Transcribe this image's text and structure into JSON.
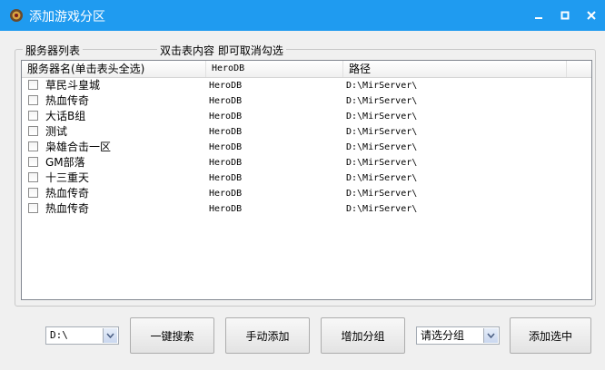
{
  "window": {
    "title": "添加游戏分区"
  },
  "group": {
    "label_left": "服务器列表",
    "label_right": "双击表内容 即可取消勾选"
  },
  "table": {
    "columns": [
      "服务器名(单击表头全选)",
      "HeroDB",
      "路径"
    ],
    "rows": [
      {
        "name": "草民斗皇城",
        "db": "HeroDB",
        "path": "D:\\MirServer\\"
      },
      {
        "name": "热血传奇",
        "db": "HeroDB",
        "path": "D:\\MirServer\\"
      },
      {
        "name": "大话B组",
        "db": "HeroDB",
        "path": "D:\\MirServer\\"
      },
      {
        "name": "测试",
        "db": "HeroDB",
        "path": "D:\\MirServer\\"
      },
      {
        "name": "枭雄合击一区",
        "db": "HeroDB",
        "path": "D:\\MirServer\\"
      },
      {
        "name": "GM部落",
        "db": "HeroDB",
        "path": "D:\\MirServer\\"
      },
      {
        "name": "十三重天",
        "db": "HeroDB",
        "path": "D:\\MirServer\\"
      },
      {
        "name": "热血传奇",
        "db": "HeroDB",
        "path": "D:\\MirServer\\"
      },
      {
        "name": "热血传奇",
        "db": "HeroDB",
        "path": "D:\\MirServer\\"
      }
    ]
  },
  "toolbar": {
    "drive_value": "D:\\",
    "search_label": "一键搜索",
    "manual_add_label": "手动添加",
    "add_group_label": "增加分组",
    "group_select_value": "请选分组",
    "add_selected_label": "添加选中"
  },
  "colors": {
    "titlebar": "#1f9bf0",
    "window_bg": "#f0f0f0"
  },
  "icons": {
    "app": "gear-icon",
    "minimize": "minimize-icon",
    "maximize": "maximize-icon",
    "close": "close-icon",
    "dropdown": "chevron-down-icon"
  }
}
